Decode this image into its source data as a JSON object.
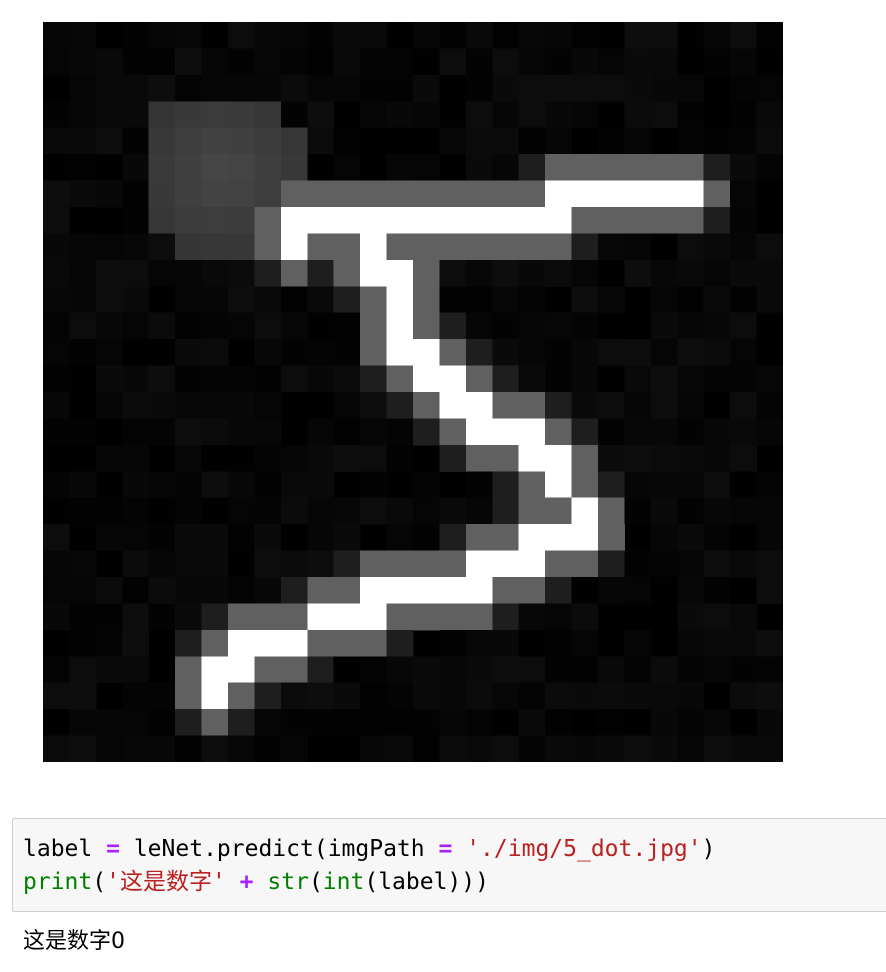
{
  "output_image": {
    "description_icon": "digit-image",
    "grid_size": 28,
    "background": "#000000"
  },
  "code_cell": {
    "line1": {
      "var": "label",
      "op": "=",
      "call": "leNet.predict(imgPath",
      "op2": "=",
      "str": "'./img/5_dot.jpg'",
      "close": ")"
    },
    "line2": {
      "fn": "print",
      "open": "(",
      "str": "'这是数字'",
      "op": "+",
      "fn2": "str",
      "open2": "(",
      "fn3": "int",
      "rest": "(label)))"
    }
  },
  "stdout": {
    "text": "这是数字0"
  }
}
